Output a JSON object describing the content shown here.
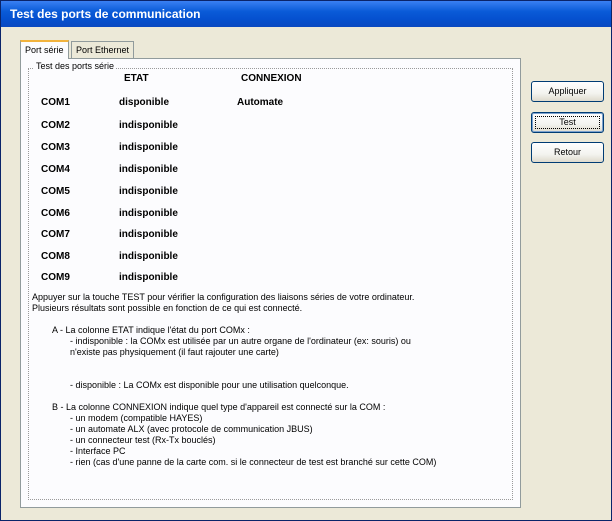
{
  "window": {
    "title": "Test des ports de communication"
  },
  "tabs": [
    {
      "label": "Port série",
      "active": true
    },
    {
      "label": "Port Ethernet",
      "active": false
    }
  ],
  "group": {
    "legend": "Test des ports série",
    "columns": {
      "etat": "ETAT",
      "connexion": "CONNEXION"
    },
    "rows": [
      {
        "port": "COM1",
        "etat": "disponible",
        "connexion": "Automate"
      },
      {
        "port": "COM2",
        "etat": "indisponible",
        "connexion": ""
      },
      {
        "port": "COM3",
        "etat": "indisponible",
        "connexion": ""
      },
      {
        "port": "COM4",
        "etat": "indisponible",
        "connexion": ""
      },
      {
        "port": "COM5",
        "etat": "indisponible",
        "connexion": ""
      },
      {
        "port": "COM6",
        "etat": "indisponible",
        "connexion": ""
      },
      {
        "port": "COM7",
        "etat": "indisponible",
        "connexion": ""
      },
      {
        "port": "COM8",
        "etat": "indisponible",
        "connexion": ""
      },
      {
        "port": "COM9",
        "etat": "indisponible",
        "connexion": ""
      }
    ],
    "info": {
      "l1": "Appuyer sur la touche TEST pour vérifier la configuration des liaisons séries de votre ordinateur.",
      "l2": "Plusieurs résultats sont possible en fonction de ce qui est connecté.",
      "a_title": "A - La colonne ETAT indique l'état du port COMx :",
      "a1": "- indisponible : la COMx est utilisée par un autre organe de l'ordinateur (ex: souris) ou",
      "a2": "n'existe pas physiquement (il faut rajouter une carte)",
      "a3": "- disponible : La COMx est disponible pour une utilisation quelconque.",
      "b_title": "B - La colonne CONNEXION indique quel type d'appareil est connecté sur la COM :",
      "b1": "- un modem (compatible HAYES)",
      "b2": "- un automate ALX (avec protocole de communication JBUS)",
      "b3": "- un connecteur test (Rx-Tx bouclés)",
      "b4": "- Interface PC",
      "b5": "- rien (cas d'une panne de la carte com. si le connecteur de test est branché sur cette COM)"
    }
  },
  "buttons": {
    "apply": "Appliquer",
    "test": "Test",
    "back": "Retour"
  },
  "colors": {
    "title_bar": "#0a5bd8",
    "window_bg": "#ece9d8",
    "panel_bg": "#fcfcfe",
    "tab_highlight": "#f2b33d"
  }
}
